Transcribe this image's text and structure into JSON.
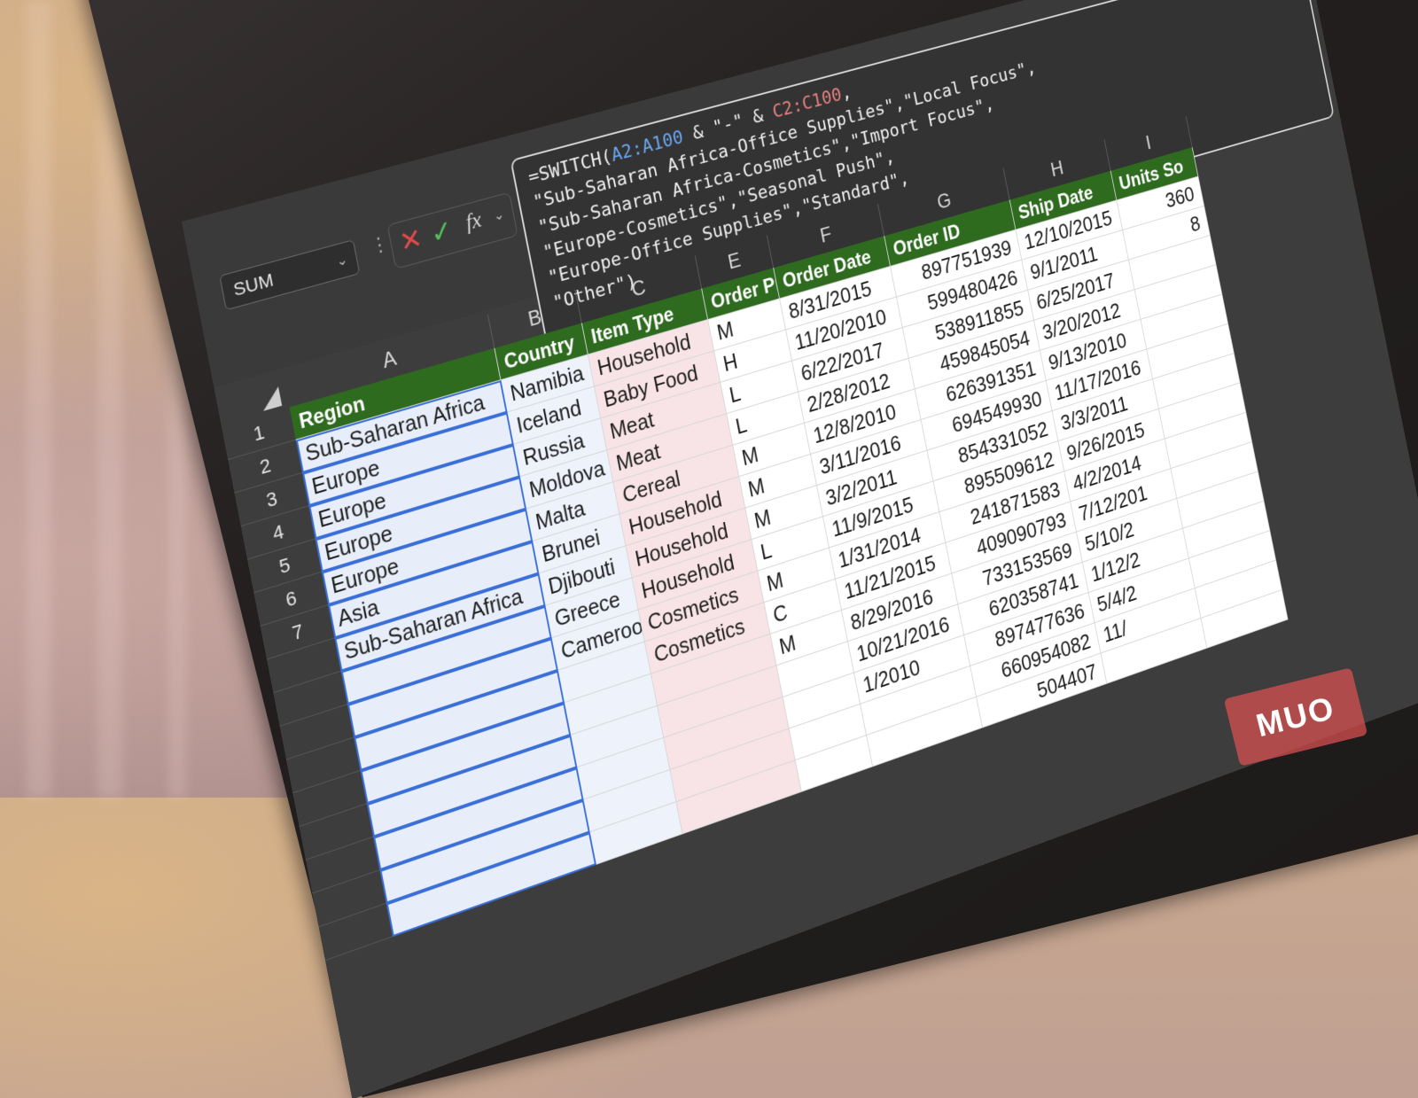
{
  "name_box": {
    "value": "SUM"
  },
  "formula_bar": {
    "lines": [
      [
        "=SWITCH(",
        "A2:A100",
        " & \"-\" & ",
        "C2:C100",
        ","
      ],
      [
        "\"Sub-Saharan Africa-Office Supplies\",\"Local Focus\","
      ],
      [
        "\"Sub-Saharan Africa-Cosmetics\",\"Import Focus\","
      ],
      [
        "\"Europe-Cosmetics\",\"Seasonal Push\","
      ],
      [
        "\"Europe-Office Supplies\",\"Standard\","
      ],
      [
        "\"Other\")"
      ]
    ]
  },
  "columns": [
    "A",
    "B",
    "C",
    "E",
    "F",
    "G",
    "H",
    "I"
  ],
  "header_row": [
    "Region",
    "Country",
    "Item Type",
    "Order Pr",
    "Order Date",
    "Order ID",
    "Ship Date",
    "Units So"
  ],
  "row_numbers": [
    "1",
    "2",
    "3",
    "4",
    "5",
    "6",
    "7"
  ],
  "rows": [
    [
      "Sub-Saharan Africa",
      "Namibia",
      "Household",
      "M",
      "8/31/2015",
      "897751939",
      "12/10/2015",
      "360"
    ],
    [
      "Europe",
      "Iceland",
      "Baby Food",
      "H",
      "11/20/2010",
      "599480426",
      "9/1/2011",
      "8"
    ],
    [
      "Europe",
      "Russia",
      "Meat",
      "L",
      "6/22/2017",
      "538911855",
      "6/25/2017",
      ""
    ],
    [
      "Europe",
      "Moldova",
      "Meat",
      "L",
      "2/28/2012",
      "459845054",
      "3/20/2012",
      ""
    ],
    [
      "Europe",
      "Malta",
      "Cereal",
      "M",
      "12/8/2010",
      "626391351",
      "9/13/2010",
      ""
    ],
    [
      "Asia",
      "Brunei",
      "Household",
      "M",
      "3/11/2016",
      "694549930",
      "11/17/2016",
      ""
    ],
    [
      "Sub-Saharan Africa",
      "Djibouti",
      "Household",
      "M",
      "3/2/2011",
      "854331052",
      "3/3/2011",
      ""
    ],
    [
      "",
      "Greece",
      "Household",
      "L",
      "11/9/2015",
      "895509612",
      "9/26/2015",
      ""
    ],
    [
      "",
      "Cameroon",
      "Cosmetics",
      "M",
      "1/31/2014",
      "241871583",
      "4/2/2014",
      ""
    ],
    [
      "",
      "",
      "Cosmetics",
      "C",
      "11/21/2015",
      "409090793",
      "7/12/201",
      ""
    ],
    [
      "",
      "",
      "",
      "M",
      "8/29/2016",
      "733153569",
      "5/10/2",
      ""
    ],
    [
      "",
      "",
      "",
      "",
      "10/21/2016",
      "620358741",
      "1/12/2",
      ""
    ],
    [
      "",
      "",
      "",
      "",
      "1/2010",
      "897477636",
      "5/4/2",
      ""
    ],
    [
      "",
      "",
      "",
      "",
      "",
      "660954082",
      "11/",
      ""
    ],
    [
      "",
      "",
      "",
      "",
      "",
      "504407",
      "",
      ""
    ]
  ],
  "watermark": "MUO"
}
